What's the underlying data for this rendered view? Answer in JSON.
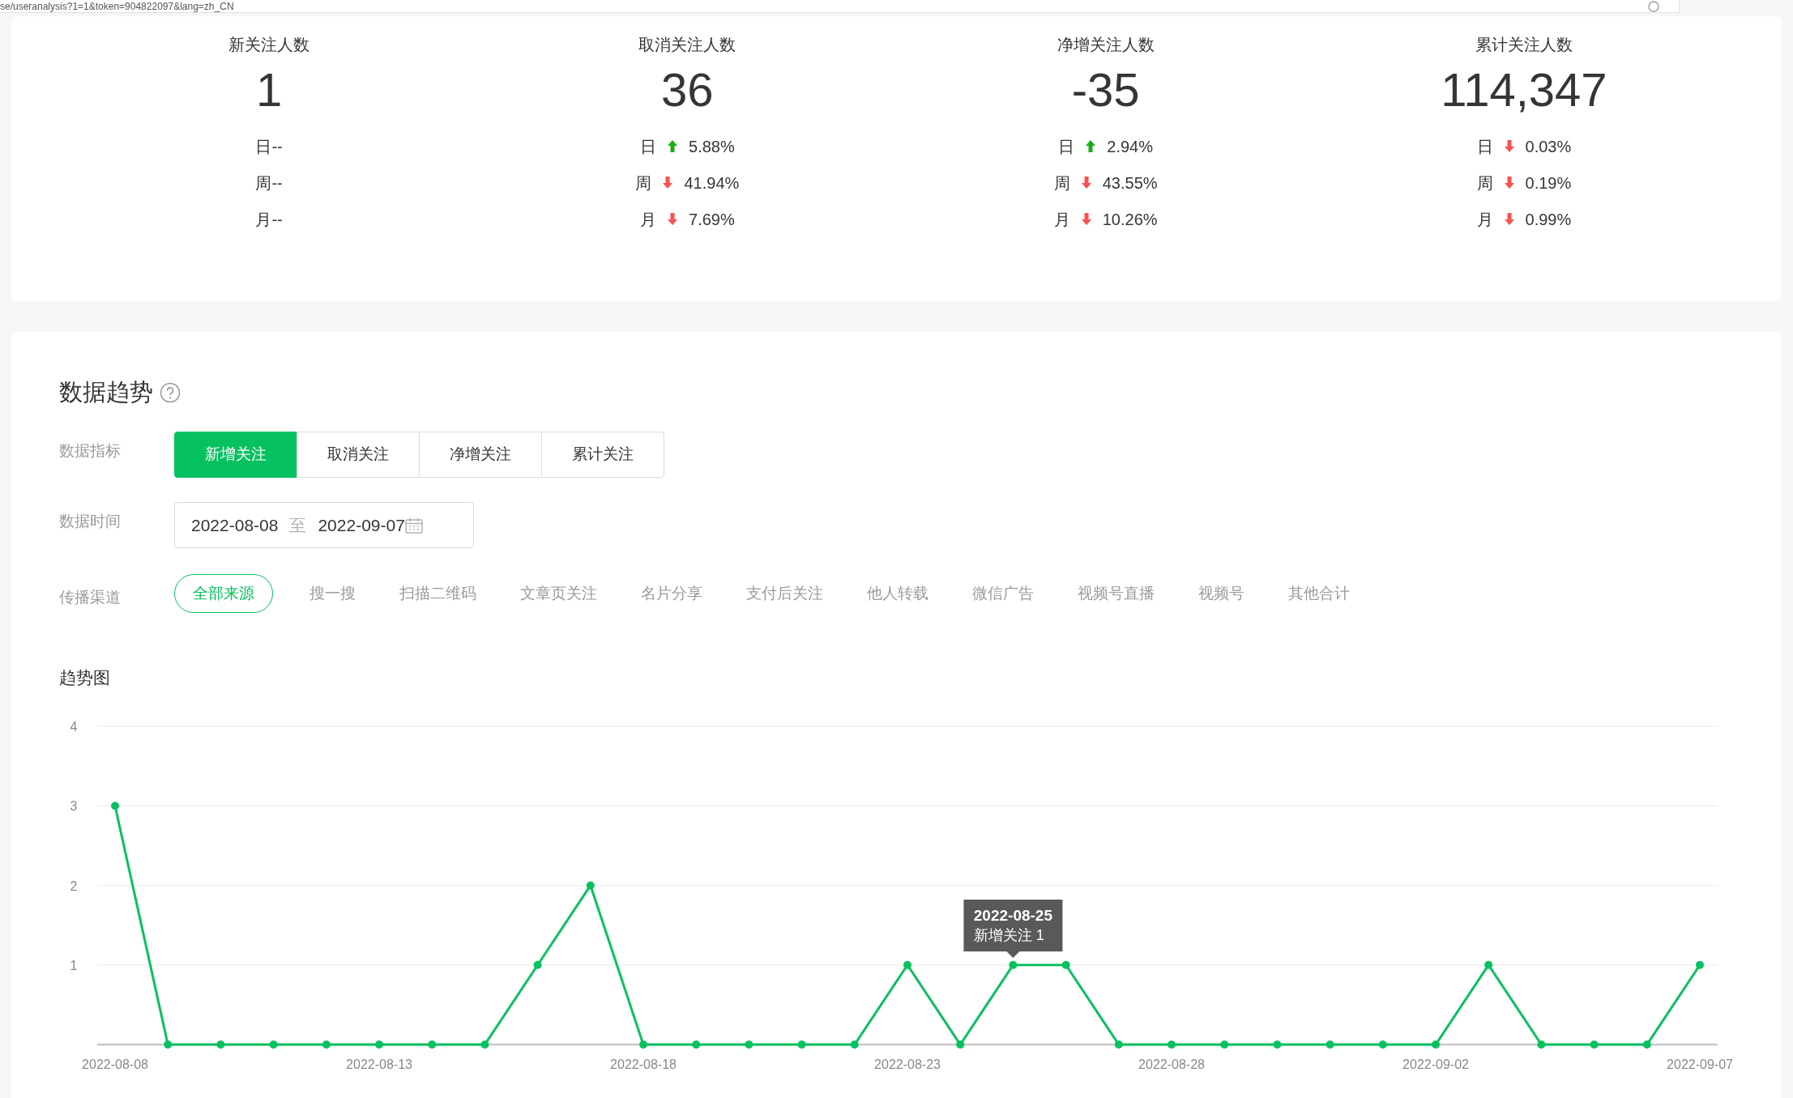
{
  "address_bar": {
    "url": "se/useranalysis?1=1&token=904822097&lang=zh_CN"
  },
  "stats": [
    {
      "title": "新关注人数",
      "value": "1",
      "changes": [
        {
          "period": "日",
          "kind": "plain",
          "value": "--"
        },
        {
          "period": "周",
          "kind": "plain",
          "value": "--"
        },
        {
          "period": "月",
          "kind": "plain",
          "value": "--"
        }
      ]
    },
    {
      "title": "取消关注人数",
      "value": "36",
      "changes": [
        {
          "period": "日",
          "kind": "up",
          "value": "5.88%"
        },
        {
          "period": "周",
          "kind": "down",
          "value": "41.94%"
        },
        {
          "period": "月",
          "kind": "down",
          "value": "7.69%"
        }
      ]
    },
    {
      "title": "净增关注人数",
      "value": "-35",
      "changes": [
        {
          "period": "日",
          "kind": "up",
          "value": "2.94%"
        },
        {
          "period": "周",
          "kind": "down",
          "value": "43.55%"
        },
        {
          "period": "月",
          "kind": "down",
          "value": "10.26%"
        }
      ]
    },
    {
      "title": "累计关注人数",
      "value": "114,347",
      "changes": [
        {
          "period": "日",
          "kind": "down",
          "value": "0.03%"
        },
        {
          "period": "周",
          "kind": "down",
          "value": "0.19%"
        },
        {
          "period": "月",
          "kind": "down",
          "value": "0.99%"
        }
      ]
    }
  ],
  "trend": {
    "title": "数据趋势",
    "metric": {
      "label": "数据指标",
      "options": [
        {
          "label": "新增关注",
          "selected": true
        },
        {
          "label": "取消关注",
          "selected": false
        },
        {
          "label": "净增关注",
          "selected": false
        },
        {
          "label": "累计关注",
          "selected": false
        }
      ]
    },
    "time": {
      "label": "数据时间",
      "start": "2022-08-08",
      "separator": "至",
      "end": "2022-09-07"
    },
    "channel": {
      "label": "传播渠道",
      "options": [
        {
          "label": "全部来源",
          "selected": true
        },
        {
          "label": "搜一搜",
          "selected": false
        },
        {
          "label": "扫描二维码",
          "selected": false
        },
        {
          "label": "文章页关注",
          "selected": false
        },
        {
          "label": "名片分享",
          "selected": false
        },
        {
          "label": "支付后关注",
          "selected": false
        },
        {
          "label": "他人转载",
          "selected": false
        },
        {
          "label": "微信广告",
          "selected": false
        },
        {
          "label": "视频号直播",
          "selected": false
        },
        {
          "label": "视频号",
          "selected": false
        },
        {
          "label": "其他合计",
          "selected": false
        }
      ]
    },
    "chart_title": "趋势图",
    "chart_data": {
      "type": "line",
      "categories": [
        "2022-08-08",
        null,
        null,
        null,
        null,
        "2022-08-13",
        null,
        null,
        null,
        null,
        "2022-08-18",
        null,
        null,
        null,
        null,
        "2022-08-23",
        null,
        null,
        null,
        null,
        "2022-08-28",
        null,
        null,
        null,
        null,
        "2022-09-02",
        null,
        null,
        null,
        null,
        "2022-09-07"
      ],
      "series": [
        {
          "color": "#07c160",
          "marker": true,
          "values": [
            3,
            0,
            0,
            0,
            0,
            0,
            0,
            0,
            1,
            2,
            0,
            0,
            0,
            0,
            0,
            1,
            0,
            1,
            1,
            0,
            0,
            0,
            0,
            0,
            0,
            0,
            1,
            0,
            0,
            0,
            1
          ]
        }
      ],
      "ylim": [
        0,
        4
      ],
      "yticks": [
        1,
        2,
        3,
        4
      ],
      "grid": true
    },
    "tooltip": {
      "date": "2022-08-25",
      "text": "新增关注 1"
    }
  }
}
